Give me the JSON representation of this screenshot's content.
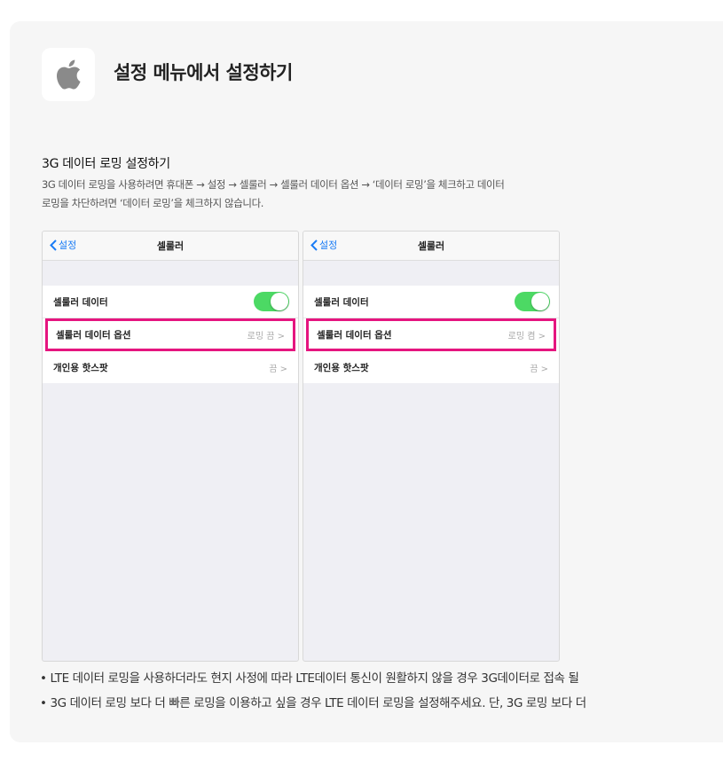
{
  "header": {
    "title": "설정 메뉴에서 설정하기",
    "logo_icon": "apple-logo"
  },
  "section": {
    "subtitle": "3G 데이터 로밍 설정하기",
    "desc_line1": "3G 데이터 로밍을 사용하려면 휴대폰 → 설정 → 셀룰러 → 셀룰러 데이터 옵션 → ‘데이터 로밍’을 체크하고 데이터",
    "desc_line2": "로밍을 차단하려면 ‘데이터 로밍’을 체크하지 않습니다."
  },
  "phones": [
    {
      "back_label": "설정",
      "nav_title": "셀룰러",
      "rows": [
        {
          "label": "셀룰러 데이터",
          "toggle": true
        },
        {
          "label": "셀룰러 데이터 옵션",
          "value": "로밍 끔 >"
        },
        {
          "label": "개인용 핫스팟",
          "value": "끔 >"
        }
      ]
    },
    {
      "back_label": "설정",
      "nav_title": "셀룰러",
      "rows": [
        {
          "label": "셀룰러 데이터",
          "toggle": true
        },
        {
          "label": "셀룰러 데이터 옵션",
          "value": "로밍 켬 >"
        },
        {
          "label": "개인용 핫스팟",
          "value": "끔 >"
        }
      ]
    }
  ],
  "notes": [
    "• LTE 데이터 로밍을 사용하더라도 현지 사정에 따라 LTE데이터 통신이 원활하지 않을 경우 3G데이터로 접속 될",
    "• 3G 데이터 로밍 보다 더 빠른 로밍을 이용하고 싶을 경우 LTE 데이터 로밍을 설정해주세요. 단, 3G 로밍 보다 더"
  ],
  "colors": {
    "highlight": "#e5157f",
    "toggle_on": "#4cd964",
    "ios_blue": "#1a7cf5"
  }
}
